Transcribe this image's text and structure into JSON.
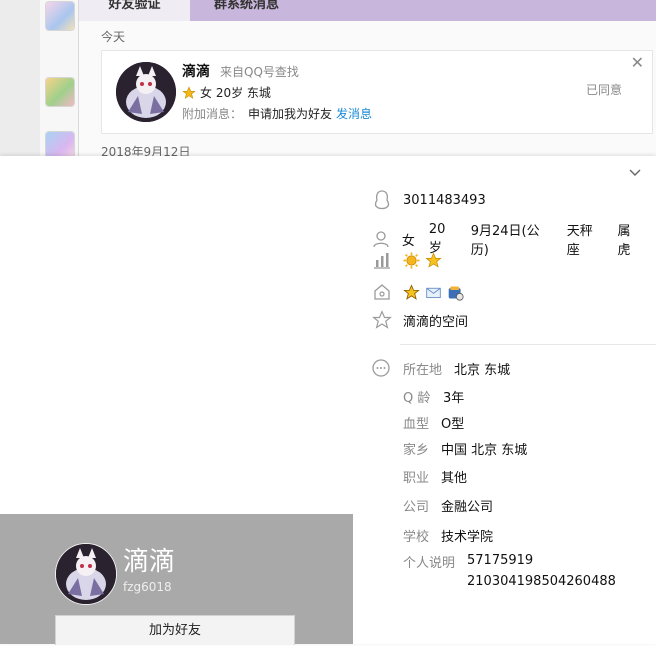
{
  "bg_window": {
    "tabs": [
      "好友验证",
      "群系统消息"
    ],
    "today_label": "今天",
    "date_label": "2018年9月12日",
    "request": {
      "name": "滴滴",
      "source": "来自QQ号查找",
      "info": "女 20岁 东城",
      "extra_label": "附加消息：",
      "extra_message": "申请加我为好友",
      "send_link": "发消息",
      "status": "已同意",
      "close_glyph": "✕"
    }
  },
  "profile": {
    "qq_number": "3011483493",
    "basic": {
      "gender": "女",
      "age": "20岁",
      "birthday": "9月24日(公历)",
      "constellation": "天秤座",
      "zodiac": "属虎"
    },
    "space": "滴滴的空间",
    "details": [
      {
        "label": "所在地",
        "value": "北京 东城"
      },
      {
        "label": "Q 龄",
        "value": "3年"
      },
      {
        "label": "血型",
        "value": "O型"
      },
      {
        "label": "家乡",
        "value": "中国 北京 东城"
      },
      {
        "label": "职业",
        "value": "其他"
      },
      {
        "label": "公司",
        "value": "金融公司"
      },
      {
        "label": "学校",
        "value": "技术学院"
      },
      {
        "label": "个人说明",
        "value": "57175919"
      }
    ],
    "description_line2": "210304198504260488",
    "card": {
      "name": "滴滴",
      "id": "fzg6018",
      "add_button": "加为好友"
    }
  },
  "colors": {
    "tab_bar": "#c9b6dc",
    "link": "#1a8ad4",
    "card_grey": "#a9a9a9"
  }
}
